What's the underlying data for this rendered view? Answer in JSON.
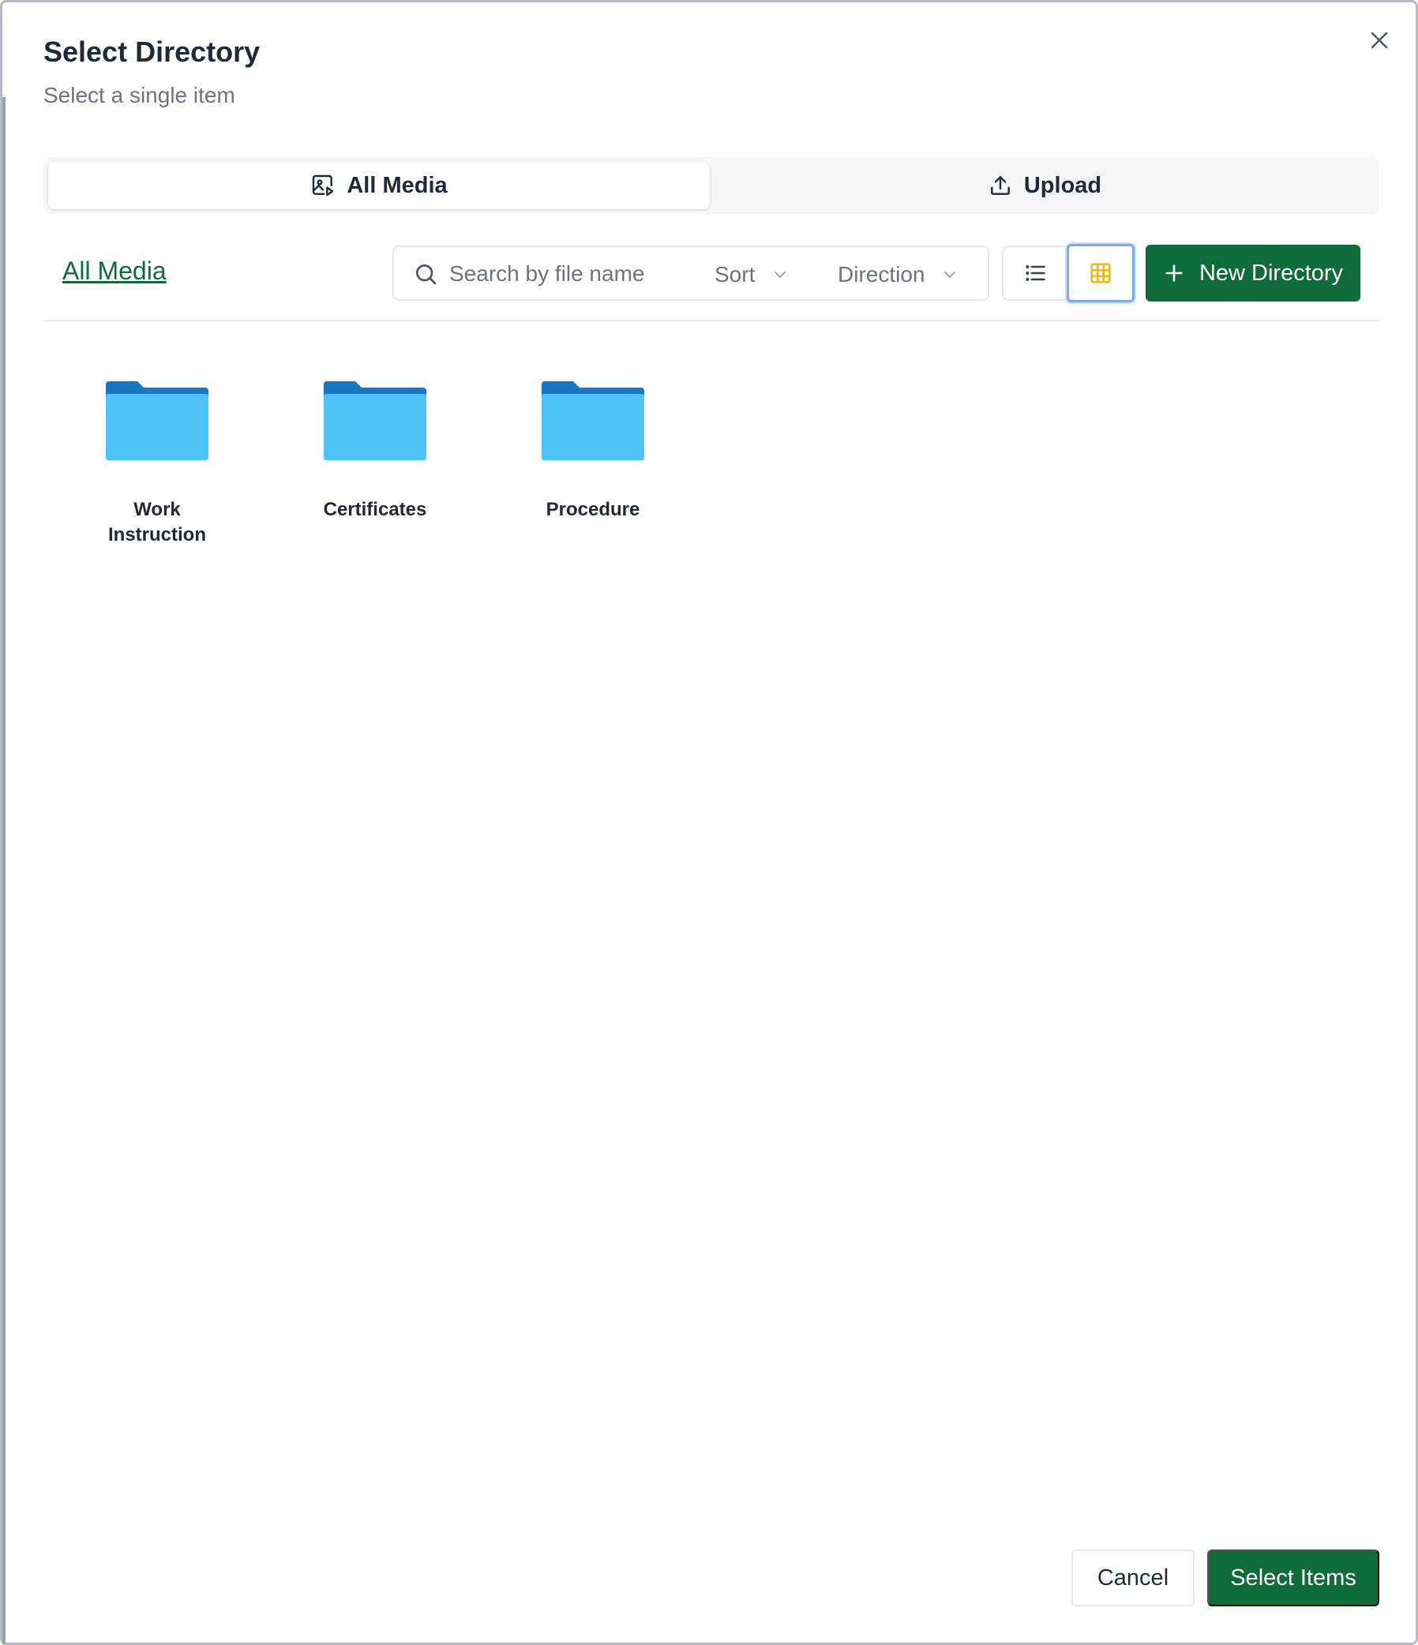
{
  "dialog": {
    "title": "Select Directory",
    "subtitle": "Select a single item"
  },
  "tabs": [
    {
      "label": "All Media",
      "icon": "media-icon",
      "active": true
    },
    {
      "label": "Upload",
      "icon": "upload-icon",
      "active": false
    }
  ],
  "breadcrumb": {
    "label": "All Media"
  },
  "search": {
    "placeholder": "Search by file name",
    "value": ""
  },
  "sort": {
    "label": "Sort"
  },
  "direction": {
    "label": "Direction"
  },
  "view_mode": {
    "selected": "grid"
  },
  "new_directory": {
    "label": "New Directory"
  },
  "folders": [
    {
      "name_line1": "Work",
      "name_line2": "Instruction"
    },
    {
      "name_line1": "Certificates",
      "name_line2": ""
    },
    {
      "name_line1": "Procedure",
      "name_line2": ""
    }
  ],
  "footer": {
    "cancel_label": "Cancel",
    "select_label": "Select Items"
  },
  "colors": {
    "primary": "#0f6b3a",
    "folder_front": "#4fc3f7",
    "folder_back": "#1976c2",
    "grid_icon": "#f2b400",
    "focus_ring": "#7da7ee"
  }
}
